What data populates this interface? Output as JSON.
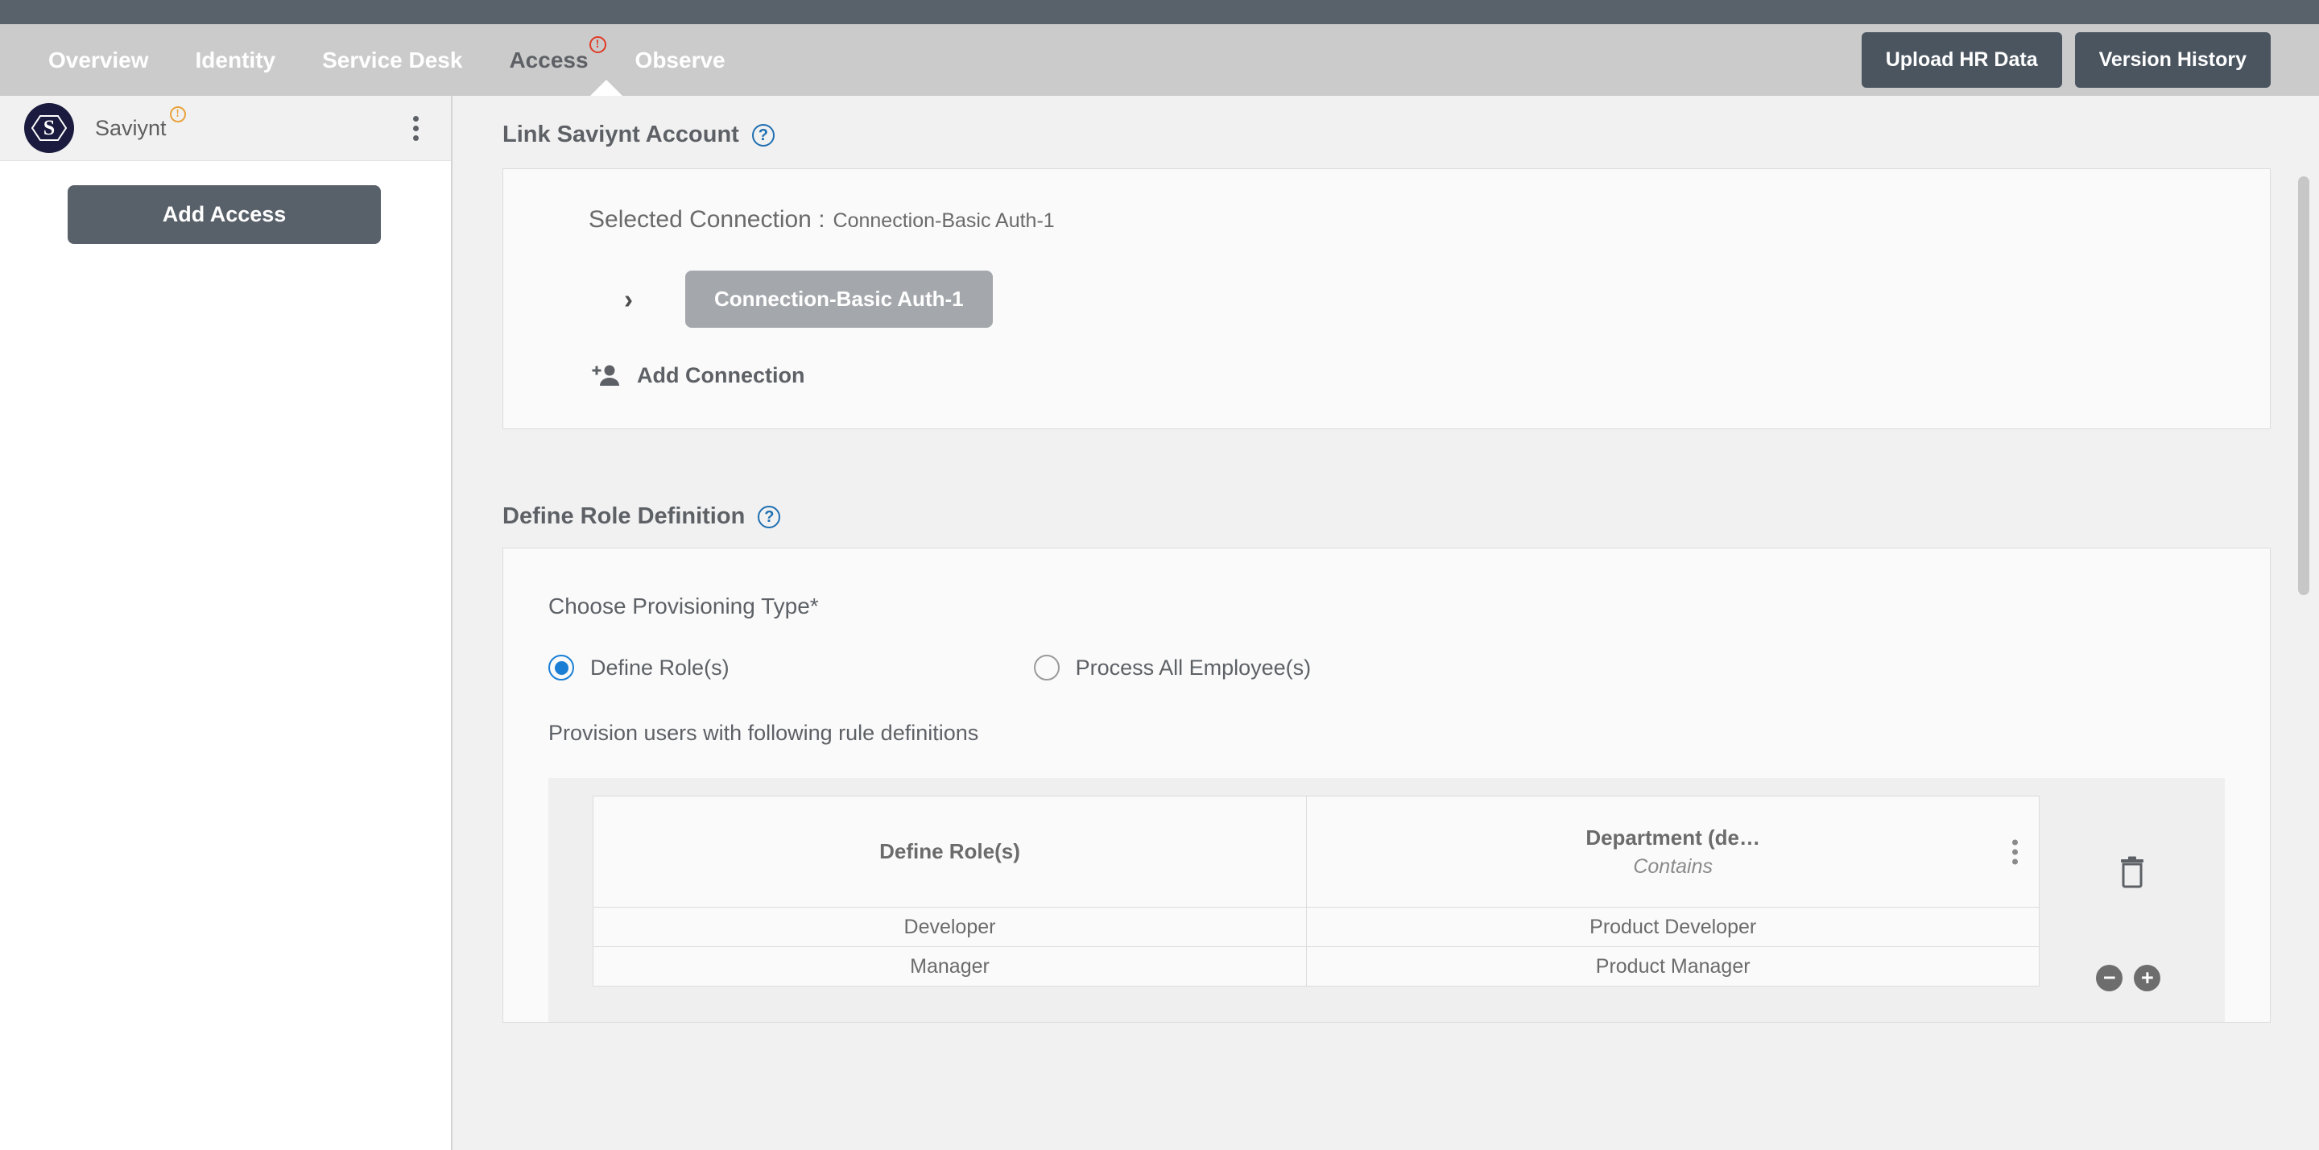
{
  "nav": {
    "items": [
      {
        "label": "Overview",
        "active": false
      },
      {
        "label": "Identity",
        "active": false
      },
      {
        "label": "Service Desk",
        "active": false
      },
      {
        "label": "Access",
        "active": true,
        "badge": "!"
      },
      {
        "label": "Observe",
        "active": false
      }
    ],
    "upload_label": "Upload HR Data",
    "version_label": "Version History",
    "access_badge": "!"
  },
  "sidebar": {
    "org_name": "Saviynt",
    "org_badge": "!",
    "logo_letter": "S",
    "add_access_label": "Add Access"
  },
  "link_account": {
    "title": "Link Saviynt Account",
    "help": "?",
    "selected_label": "Selected Connection :",
    "selected_value": "Connection-Basic Auth-1",
    "chevron": "›",
    "connection_pill": "Connection-Basic Auth-1",
    "add_connection_label": "Add Connection"
  },
  "role_definition": {
    "title": "Define Role Definition",
    "help": "?",
    "choose_label": "Choose Provisioning Type*",
    "options": [
      {
        "label": "Define Role(s)",
        "selected": true
      },
      {
        "label": "Process All Employee(s)",
        "selected": false
      }
    ],
    "provision_note": "Provision users with following rule definitions",
    "table": {
      "columns": [
        {
          "header": "Define Role(s)",
          "sub": ""
        },
        {
          "header": "Department (de…",
          "sub": "Contains"
        }
      ],
      "rows": [
        {
          "role": "Developer",
          "department": "Product Developer"
        },
        {
          "role": "Manager",
          "department": "Product Manager"
        }
      ]
    },
    "minus_label": "−",
    "plus_label": "+"
  },
  "colors": {
    "top_strip": "#59616b",
    "navbar": "#cbcbcb",
    "accent_blue": "#1a7fd4",
    "warning_red": "#e03a24",
    "warning_orange": "#e8a33d",
    "button_slate": "#4a5560"
  }
}
